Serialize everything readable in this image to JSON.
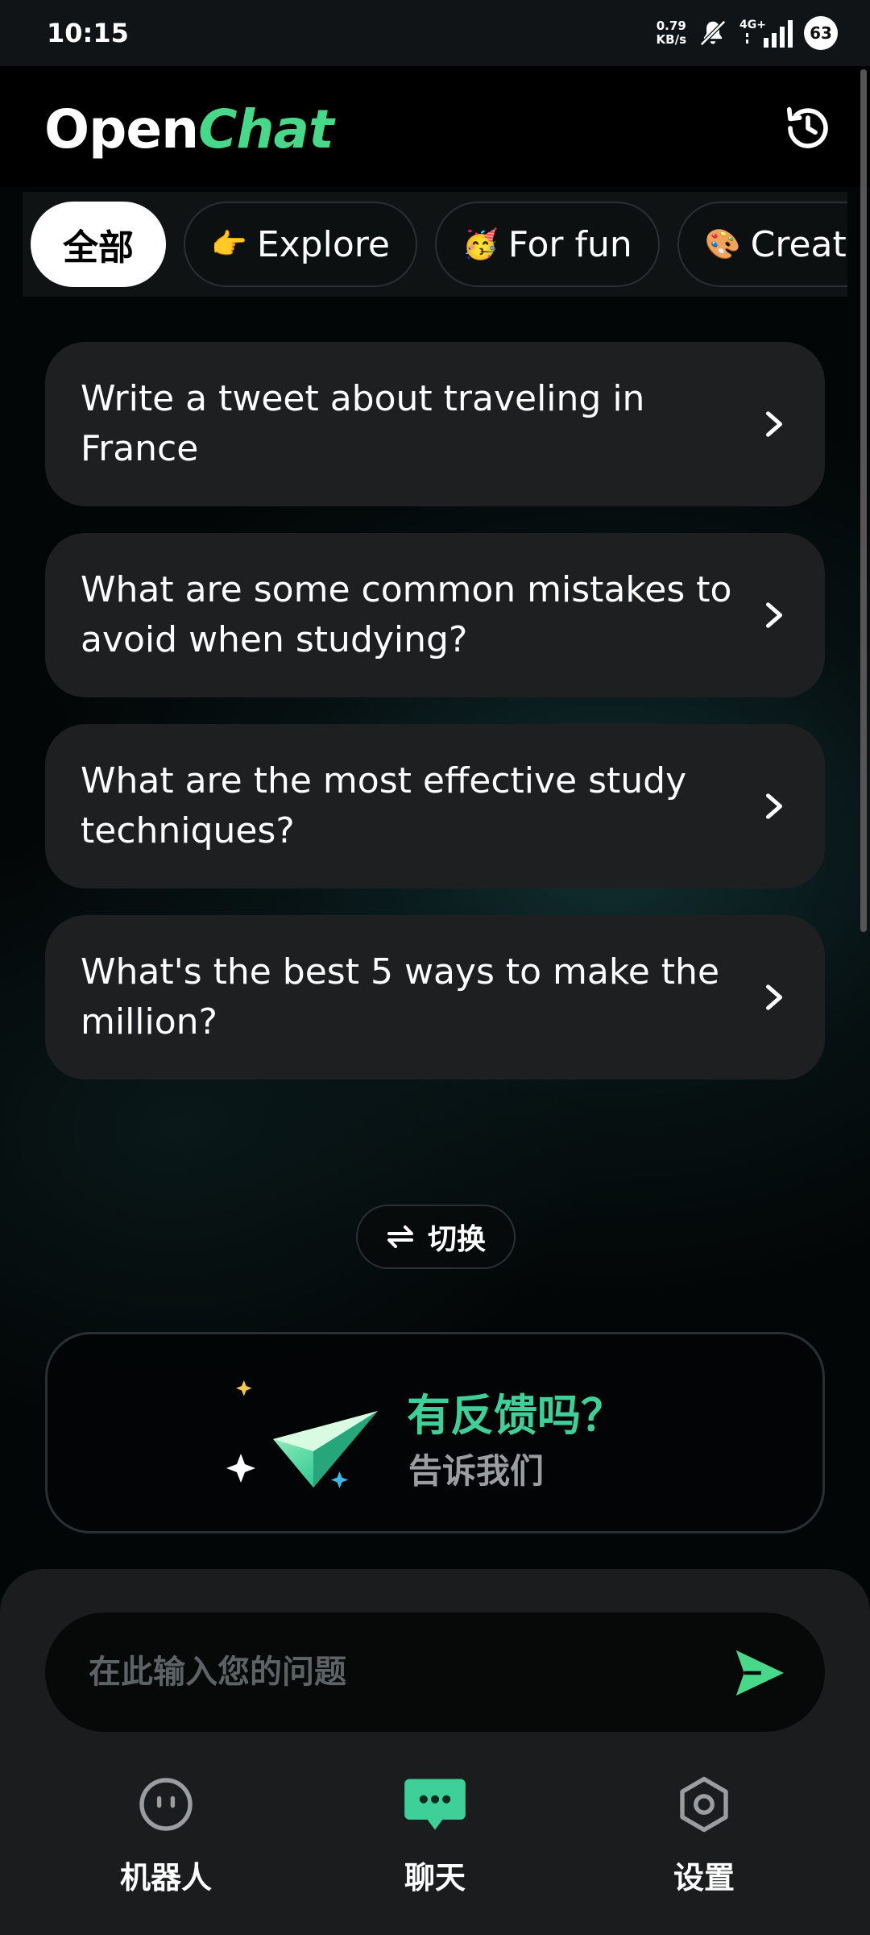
{
  "status_bar": {
    "time": "10:15",
    "net_speed_value": "0.79",
    "net_speed_unit": "KB/s",
    "network": "4G+",
    "battery": "63"
  },
  "header": {
    "logo_part1": "Open",
    "logo_part2": "Chat",
    "history_icon": "history-icon"
  },
  "categories": [
    {
      "label": "全部",
      "emoji": "",
      "active": true
    },
    {
      "label": "Explore",
      "emoji": "👉",
      "active": false
    },
    {
      "label": "For fun",
      "emoji": "🥳",
      "active": false
    },
    {
      "label": "Creativ",
      "emoji": "🎨",
      "active": false
    }
  ],
  "suggestions": [
    {
      "text": "Write a tweet about traveling in France"
    },
    {
      "text": "What are some common mistakes to avoid when studying?"
    },
    {
      "text": "What are the most effective study techniques?"
    },
    {
      "text": "What's the best 5 ways to make the million?"
    }
  ],
  "switch_label": "切换",
  "feedback": {
    "title": "有反馈吗？",
    "subtitle": "告诉我们"
  },
  "input": {
    "placeholder": "在此输入您的问题",
    "value": ""
  },
  "nav": {
    "items": [
      {
        "label": "机器人",
        "icon": "robot-icon"
      },
      {
        "label": "聊天",
        "icon": "chat-icon"
      },
      {
        "label": "设置",
        "icon": "settings-icon"
      }
    ]
  },
  "colors": {
    "accent": "#48d88a",
    "feedback_title": "#3fd09a",
    "card_bg": "#1d1f20"
  }
}
